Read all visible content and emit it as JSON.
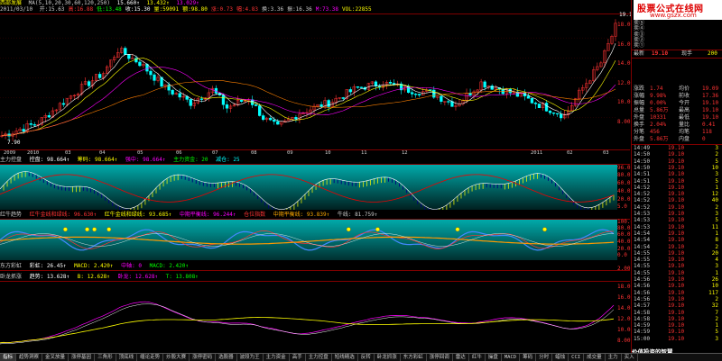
{
  "header": {
    "title": "西部发展",
    "ma_label": "MA(5,10,20,30,60,120,250)",
    "ma_values": [
      "15.660↑",
      "13.432↑",
      "13.029↑"
    ],
    "date": "2011/03/10",
    "row2_items": [
      "开:15.63",
      "高:16.88",
      "低:13.48",
      "收:15.30",
      "量:59091",
      "额:98.80",
      "涨:0.73",
      "幅:4.83",
      "换:3.36",
      "振:16.36",
      "M:73.38",
      "VOL:22855"
    ]
  },
  "kline": {
    "dates_axis": [
      "2009",
      "2010",
      "03",
      "04",
      "05",
      "06",
      "07",
      "08",
      "09",
      "10",
      "11",
      "12",
      "2011",
      "02",
      "03"
    ],
    "price_labels": [
      "19.10",
      "18.00",
      "16.00",
      "14.00",
      "12.00",
      "10.00",
      "8.00"
    ],
    "low_label": "7.90",
    "high_label": "19.10"
  },
  "panel2": {
    "title_items": [
      "主力控盘",
      "控盘: 98.664↑",
      "筹码: 98.664↑",
      "强中: 98.664↑",
      "主力资金: 20",
      "减仓: 25"
    ],
    "labels": [
      "96.0",
      "80.0",
      "60.0",
      "40.0",
      "20.0",
      "5.0"
    ]
  },
  "panel3": {
    "title_items": [
      "红牛趋势",
      "红牛金线和绿线: 96.630↑",
      "红牛金线和绿线: 93.685↑",
      "中期平衡线: 96.244↑",
      "仓位指数",
      "中期平衡线: 93.839↑",
      "牛线: 81.759↑"
    ],
    "labels": [
      "100.0",
      "80.0",
      "60.0",
      "40.0",
      "20.0",
      "0.0"
    ]
  },
  "panel4": {
    "title_items": [
      "东方彩虹",
      "彩虹: 26.45↑",
      "MACD: 2.420↑",
      "中轴: 0",
      "MACD: 2.420↑"
    ],
    "labels": [
      "2.00"
    ]
  },
  "panel5": {
    "title_items": [
      "卧龙抓涨",
      "趋势: 13.628↑",
      "B: 12.628↑",
      "卧龙: 12.628↑",
      "T: 13.808↑"
    ],
    "labels": [
      "18.00",
      "16.00",
      "14.00",
      "12.00",
      "10.00",
      "8.00"
    ]
  },
  "right": {
    "order_book": [
      {
        "label": "卖⑤",
        "price": "",
        "vol": ""
      },
      {
        "label": "卖④",
        "price": "",
        "vol": ""
      },
      {
        "label": "卖③",
        "price": "",
        "vol": ""
      },
      {
        "label": "卖②",
        "price": "",
        "vol": ""
      },
      {
        "label": "卖①",
        "price": "",
        "vol": ""
      },
      {
        "label": "买①",
        "price": "19.10",
        "vol": "4"
      },
      {
        "label": "买②",
        "price": "19.09",
        "vol": "5"
      },
      {
        "label": "买③",
        "price": "19.08",
        "vol": "6"
      },
      {
        "label": "买④",
        "price": "19.07",
        "vol": "2"
      },
      {
        "label": "买⑤",
        "price": "19.05",
        "vol": "1"
      }
    ],
    "last_price_row": {
      "label": "最新",
      "price": "19.10",
      "label2": "现手",
      "vol": "200"
    },
    "quotes": [
      {
        "l1": "涨跌",
        "v1": "1.74",
        "l2": "均价",
        "v2": "19.09"
      },
      {
        "l1": "涨幅",
        "v1": "9.98%",
        "l2": "前收",
        "v2": "17.36"
      },
      {
        "l1": "振幅",
        "v1": "0.00%",
        "l2": "今开",
        "v2": "19.10"
      },
      {
        "l1": "总量",
        "v1": "5.86万",
        "l2": "最高",
        "v2": "19.10"
      },
      {
        "l1": "外盘",
        "v1": "10331",
        "l2": "最低",
        "v2": "19.10"
      },
      {
        "l1": "换手",
        "v1": "2.04%",
        "l2": "量比",
        "v2": "0.41"
      },
      {
        "l1": "分笔",
        "v1": "456",
        "l2": "均笔",
        "v2": "118"
      },
      {
        "l1": "外盘",
        "v1": "5.86万",
        "l2": "内盘",
        "v2": "0"
      }
    ],
    "ticks": [
      {
        "t": "14:49",
        "p": "19.10",
        "v": "3"
      },
      {
        "t": "14:50",
        "p": "19.10",
        "v": "2"
      },
      {
        "t": "14:50",
        "p": "19.10",
        "v": "5"
      },
      {
        "t": "14:50",
        "p": "19.10",
        "v": "10"
      },
      {
        "t": "14:51",
        "p": "19.10",
        "v": "3"
      },
      {
        "t": "14:51",
        "p": "19.10",
        "v": "5"
      },
      {
        "t": "14:52",
        "p": "19.10",
        "v": "1"
      },
      {
        "t": "14:52",
        "p": "19.10",
        "v": "12"
      },
      {
        "t": "14:52",
        "p": "19.10",
        "v": "40"
      },
      {
        "t": "14:52",
        "p": "19.10",
        "v": "2"
      },
      {
        "t": "14:53",
        "p": "19.10",
        "v": "3"
      },
      {
        "t": "14:53",
        "p": "19.10",
        "v": "5"
      },
      {
        "t": "14:53",
        "p": "19.10",
        "v": "11"
      },
      {
        "t": "14:54",
        "p": "19.10",
        "v": "1"
      },
      {
        "t": "14:54",
        "p": "19.10",
        "v": "8"
      },
      {
        "t": "14:54",
        "p": "19.10",
        "v": "2"
      },
      {
        "t": "14:55",
        "p": "19.10",
        "v": "20"
      },
      {
        "t": "14:55",
        "p": "19.10",
        "v": "4"
      },
      {
        "t": "14:55",
        "p": "19.10",
        "v": "3"
      },
      {
        "t": "14:55",
        "p": "19.10",
        "v": "1"
      },
      {
        "t": "14:56",
        "p": "19.10",
        "v": "26"
      },
      {
        "t": "14:56",
        "p": "19.10",
        "v": "10"
      },
      {
        "t": "14:56",
        "p": "19.10",
        "v": "117"
      },
      {
        "t": "14:56",
        "p": "19.10",
        "v": "2"
      },
      {
        "t": "14:57",
        "p": "19.10",
        "v": "32"
      },
      {
        "t": "14:58",
        "p": "19.10",
        "v": "7"
      },
      {
        "t": "14:58",
        "p": "19.10",
        "v": "2"
      },
      {
        "t": "14:59",
        "p": "19.10",
        "v": "1"
      },
      {
        "t": "14:59",
        "p": "19.10",
        "v": "5"
      },
      {
        "t": "15:00",
        "p": "19.10",
        "v": "3"
      }
    ]
  },
  "watermark": {
    "line1": "股票公式在线网",
    "line2": "www.gszx.com",
    "footer": "价值投资的智慧"
  },
  "tabs": [
    "指标",
    "趋势洞察",
    "金叉放量",
    "涨停基因",
    "三角形",
    "顶底线",
    "缠论走势",
    "炒股大赛",
    "涨停密码",
    "选股器",
    "波段为王",
    "主力资金",
    "高手",
    "主力控盘",
    "短线精选",
    "反转",
    "卧龙抓涨",
    "东方彩虹",
    "涨停回调",
    "雷达",
    "红牛",
    "操盘",
    "MACD",
    "筹码",
    "分时",
    "蜡烛",
    "CCI",
    "成交量",
    "主力",
    "买入"
  ],
  "colors": {
    "up": "#ff3333",
    "down": "#00ffff",
    "ma5": "#ffffff",
    "ma10": "#ffff00",
    "ma20": "#ff00ff",
    "grid": "#800000"
  }
}
